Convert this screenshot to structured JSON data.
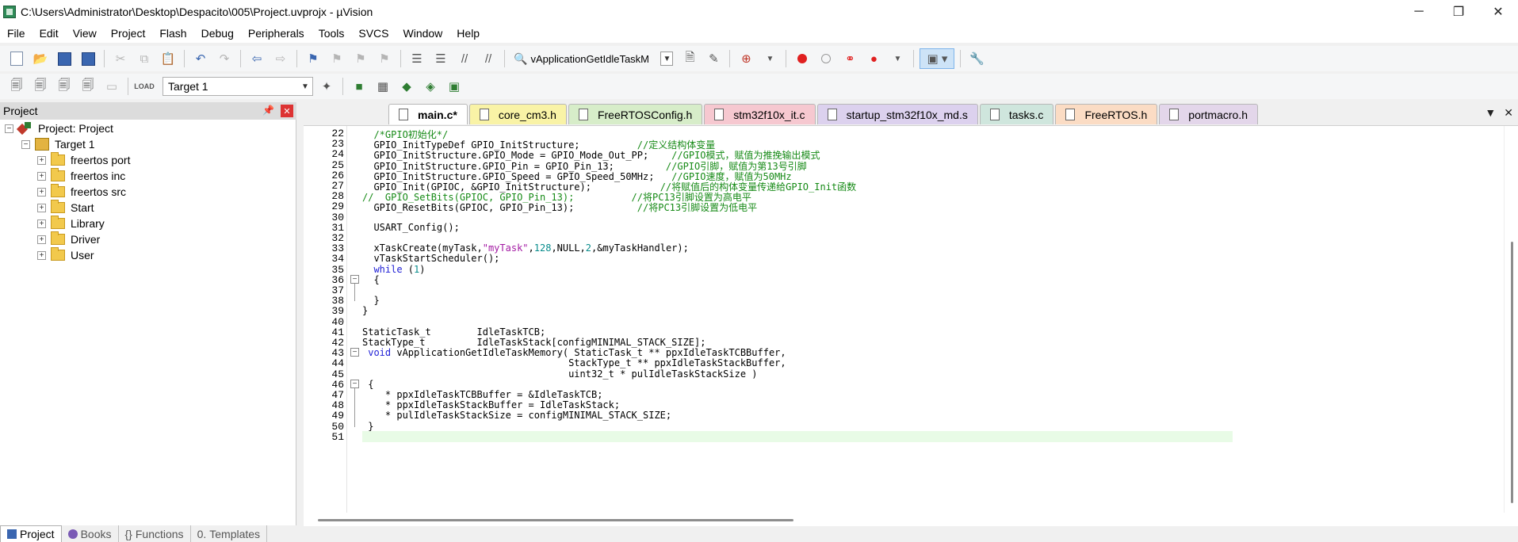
{
  "window": {
    "title": "C:\\Users\\Administrator\\Desktop\\Despacito\\005\\Project.uvprojx - µVision",
    "minimize": "─",
    "restore": "❐",
    "close": "✕"
  },
  "menu": [
    "File",
    "Edit",
    "View",
    "Project",
    "Flash",
    "Debug",
    "Peripherals",
    "Tools",
    "SVCS",
    "Window",
    "Help"
  ],
  "toolbar": {
    "function_combo_value": "vApplicationGetIdleTaskM",
    "target_combo_value": "Target 1"
  },
  "project_pane": {
    "header": "Project",
    "pin": "📌",
    "close": "✕",
    "root": "Project: Project",
    "target": "Target 1",
    "groups": [
      "freertos port",
      "freertos inc",
      "freertos src",
      "Start",
      "Library",
      "Driver",
      "User"
    ],
    "expand_symbol": "+",
    "collapse_symbol": "−"
  },
  "bottom_tabs": [
    "Project",
    "Books",
    "Functions",
    "Templates"
  ],
  "editor_tabs": [
    {
      "label": "main.c*",
      "color": "#ffffff",
      "active": true
    },
    {
      "label": "core_cm3.h",
      "color": "#f9f3a6"
    },
    {
      "label": "FreeRTOSConfig.h",
      "color": "#d7edc9"
    },
    {
      "label": "stm32f10x_it.c",
      "color": "#f6c8d0"
    },
    {
      "label": "startup_stm32f10x_md.s",
      "color": "#dcd1ee"
    },
    {
      "label": "tasks.c",
      "color": "#cfe6dd"
    },
    {
      "label": "FreeRTOS.h",
      "color": "#fbdcc4"
    },
    {
      "label": "portmacro.h",
      "color": "#e3d6ea"
    }
  ],
  "editor_controls": {
    "dropdown": "▼",
    "close": "✕"
  },
  "code": {
    "line_numbers": [
      "22",
      "23",
      "24",
      "25",
      "26",
      "27",
      "28",
      "29",
      "30",
      "31",
      "32",
      "33",
      "34",
      "35",
      "36",
      "37",
      "38",
      "39",
      "40",
      "41",
      "42",
      "43",
      "44",
      "45",
      "46",
      "47",
      "48",
      "49",
      "50",
      "51"
    ],
    "fold_markers": {
      "36": "−",
      "43": "−",
      "46": "−"
    },
    "lines": [
      [
        [
          "cm",
          "  /*GPIO初始化*/"
        ]
      ],
      [
        [
          "",
          "  GPIO_InitTypeDef GPIO_InitStructure;          "
        ],
        [
          "cm",
          "//定义结构体变量"
        ]
      ],
      [
        [
          "",
          "  GPIO_InitStructure.GPIO_Mode = GPIO_Mode_Out_PP;    "
        ],
        [
          "cm",
          "//GPIO模式，赋值为推挽输出模式"
        ]
      ],
      [
        [
          "",
          "  GPIO_InitStructure.GPIO_Pin = GPIO_Pin_13;         "
        ],
        [
          "cm",
          "//GPIO引脚，赋值为第13号引脚"
        ]
      ],
      [
        [
          "",
          "  GPIO_InitStructure.GPIO_Speed = GPIO_Speed_50MHz;   "
        ],
        [
          "cm",
          "//GPIO速度，赋值为50MHz"
        ]
      ],
      [
        [
          "",
          "  GPIO_Init(GPIOC, &GPIO_InitStructure);            "
        ],
        [
          "cm",
          "//将赋值后的构体变量传递给GPIO_Init函数"
        ]
      ],
      [
        [
          "cm",
          "//  GPIO_SetBits(GPIOC, GPIO_Pin_13);          //将PC13引脚设置为高电平"
        ]
      ],
      [
        [
          "",
          "  GPIO_ResetBits(GPIOC, GPIO_Pin_13);           "
        ],
        [
          "cm",
          "//将PC13引脚设置为低电平"
        ]
      ],
      [
        [
          "",
          ""
        ]
      ],
      [
        [
          "",
          "  USART_Config();"
        ]
      ],
      [
        [
          "",
          ""
        ]
      ],
      [
        [
          "",
          "  xTaskCreate(myTask,"
        ],
        [
          "st",
          "\"myTask\""
        ],
        [
          "",
          ","
        ],
        [
          "nm",
          "128"
        ],
        [
          "",
          ",NULL,"
        ],
        [
          "nm",
          "2"
        ],
        [
          "",
          ",&myTaskHandler);"
        ]
      ],
      [
        [
          "",
          "  vTaskStartScheduler();"
        ]
      ],
      [
        [
          "kw",
          "  while"
        ],
        [
          "",
          " ("
        ],
        [
          "nm",
          "1"
        ],
        [
          "",
          ")"
        ]
      ],
      [
        [
          "",
          "  {"
        ]
      ],
      [
        [
          "",
          ""
        ]
      ],
      [
        [
          "",
          "  }"
        ]
      ],
      [
        [
          "",
          "}"
        ]
      ],
      [
        [
          "",
          ""
        ]
      ],
      [
        [
          "",
          "StaticTask_t        IdleTaskTCB;"
        ]
      ],
      [
        [
          "",
          "StackType_t         IdleTaskStack[configMINIMAL_STACK_SIZE];"
        ]
      ],
      [
        [
          "kw",
          " void"
        ],
        [
          "",
          " vApplicationGetIdleTaskMemory( StaticTask_t ** ppxIdleTaskTCBBuffer,"
        ]
      ],
      [
        [
          "",
          "                                    StackType_t ** ppxIdleTaskStackBuffer,"
        ]
      ],
      [
        [
          "",
          "                                    uint32_t * pulIdleTaskStackSize )"
        ]
      ],
      [
        [
          "",
          " {"
        ]
      ],
      [
        [
          "",
          "    * ppxIdleTaskTCBBuffer = &IdleTaskTCB;"
        ]
      ],
      [
        [
          "",
          "    * ppxIdleTaskStackBuffer = IdleTaskStack;"
        ]
      ],
      [
        [
          "",
          "    * pulIdleTaskStackSize = configMINIMAL_STACK_SIZE;"
        ]
      ],
      [
        [
          "",
          " }"
        ]
      ],
      [
        [
          "",
          ""
        ]
      ]
    ],
    "current_line": "51"
  }
}
